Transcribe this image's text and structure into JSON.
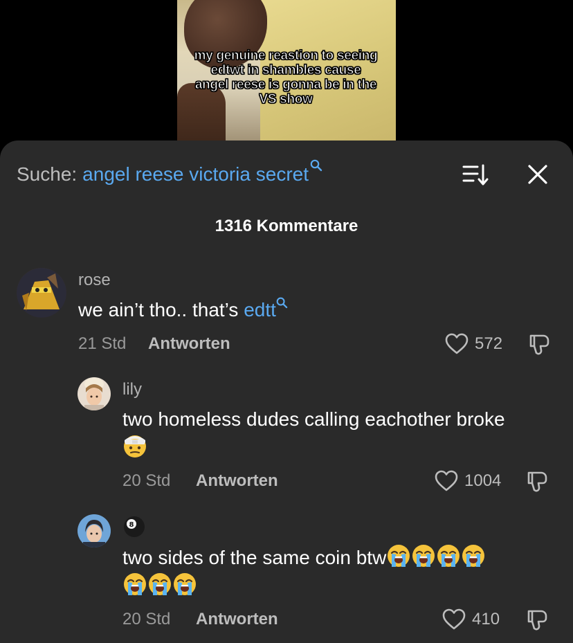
{
  "video": {
    "caption": "my genuine reastion to seeing edtwt in shambles cause angel reese is gonna be in the VS show"
  },
  "search": {
    "prefix": "Suche:",
    "query": "angel reese victoria secret"
  },
  "comments_header": {
    "count_label": "1316 Kommentare"
  },
  "comments": [
    {
      "username": "rose",
      "text": "we ain’t tho.. that’s ",
      "mention": "edtt",
      "time": "21 Std",
      "reply_label": "Antworten",
      "likes": "572"
    },
    {
      "username": "lily",
      "text": "two homeless dudes calling eachother broke",
      "emoji": [
        "face-with-head-bandage"
      ],
      "time": "20 Std",
      "reply_label": "Antworten",
      "likes": "1004"
    },
    {
      "username_emoji": "pool-8-ball",
      "text": "two sides of the same coin btw",
      "emoji": [
        "loudly-crying-face",
        "loudly-crying-face",
        "loudly-crying-face",
        "loudly-crying-face",
        "loudly-crying-face",
        "loudly-crying-face",
        "loudly-crying-face"
      ],
      "time": "20 Std",
      "reply_label": "Antworten",
      "likes": "410"
    }
  ],
  "colors": {
    "sheet_bg": "#2a2a2a",
    "link": "#5aa9f0",
    "muted": "#9a9a9a"
  }
}
